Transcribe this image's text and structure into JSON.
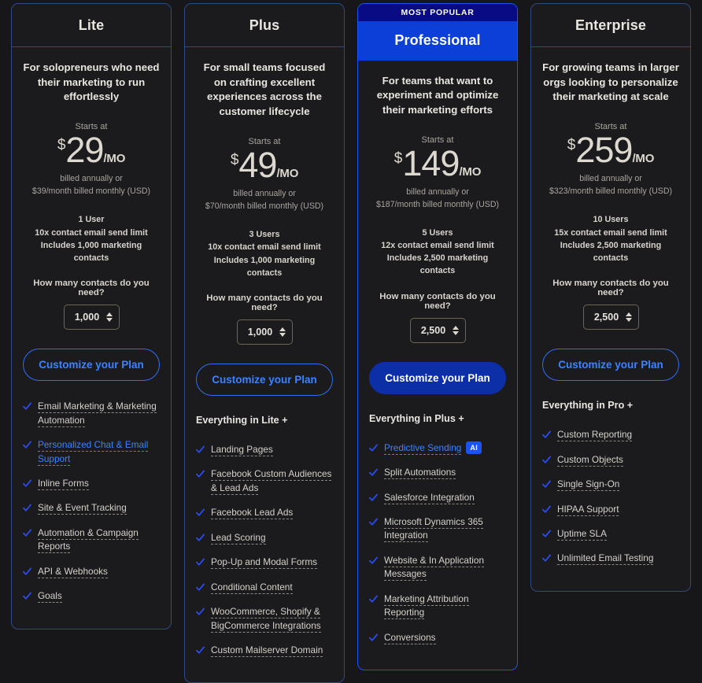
{
  "common": {
    "starts_at_label": "Starts at",
    "currency_symbol": "$",
    "period_label": "/MO",
    "contacts_question": "How many contacts do you need?",
    "cta_label": "Customize your Plan",
    "most_popular_label": "MOST POPULAR",
    "ai_badge_label": "AI",
    "check_icon": "check-icon",
    "stepper_up_icon": "arrow-up-icon",
    "stepper_down_icon": "arrow-down-icon"
  },
  "colors": {
    "page_background": "#17171a",
    "card_background": "#1b1b1e",
    "card_border": "#2c4a86",
    "featured_border": "#1a53f0",
    "featured_header": "#0b3fd8",
    "ribbon": "#080b83",
    "accent_link": "#3d82ff",
    "check_blue": "#2a4df5",
    "stepper_border": "#6e6650",
    "price_text": "#ddd9d0",
    "muted_text": "#a9a59d"
  },
  "plans": [
    {
      "name": "Lite",
      "featured": false,
      "most_popular": false,
      "tagline": "For solopreneurs who need their marketing to run effortlessly",
      "price": "29",
      "billing_note_line1": "billed annually or",
      "billing_note_line2": "$39/month billed monthly (USD)",
      "limits": [
        "1 User",
        "10x contact email send limit",
        "Includes 1,000 marketing contacts"
      ],
      "contacts_value": "1,000",
      "everything_in": "",
      "features": [
        {
          "label": "Email Marketing & Marketing Automation",
          "highlight": false,
          "badge": ""
        },
        {
          "label": "Personalized Chat & Email Support",
          "highlight": true,
          "badge": ""
        },
        {
          "label": "Inline Forms",
          "highlight": false,
          "badge": ""
        },
        {
          "label": "Site & Event Tracking",
          "highlight": false,
          "badge": ""
        },
        {
          "label": "Automation & Campaign Reports",
          "highlight": false,
          "badge": ""
        },
        {
          "label": "API & Webhooks",
          "highlight": false,
          "badge": ""
        },
        {
          "label": "Goals",
          "highlight": false,
          "badge": ""
        }
      ]
    },
    {
      "name": "Plus",
      "featured": false,
      "most_popular": false,
      "tagline": "For small teams focused on crafting excellent experiences across the customer lifecycle",
      "price": "49",
      "billing_note_line1": "billed annually or",
      "billing_note_line2": "$70/month billed monthly (USD)",
      "limits": [
        "3 Users",
        "10x contact email send limit",
        "Includes 1,000 marketing contacts"
      ],
      "contacts_value": "1,000",
      "everything_in": "Everything in Lite +",
      "features": [
        {
          "label": "Landing Pages",
          "highlight": false,
          "badge": ""
        },
        {
          "label": "Facebook Custom Audiences & Lead Ads",
          "highlight": false,
          "badge": ""
        },
        {
          "label": "Facebook Lead Ads",
          "highlight": false,
          "badge": ""
        },
        {
          "label": "Lead Scoring",
          "highlight": false,
          "badge": ""
        },
        {
          "label": "Pop-Up and Modal Forms",
          "highlight": false,
          "badge": ""
        },
        {
          "label": "Conditional Content",
          "highlight": false,
          "badge": ""
        },
        {
          "label": "WooCommerce, Shopify & BigCommerce Integrations",
          "highlight": false,
          "badge": ""
        },
        {
          "label": "Custom Mailserver Domain",
          "highlight": false,
          "badge": ""
        }
      ]
    },
    {
      "name": "Professional",
      "featured": true,
      "most_popular": true,
      "tagline": "For teams that want to experiment and optimize their marketing efforts",
      "price": "149",
      "billing_note_line1": "billed annually or",
      "billing_note_line2": "$187/month billed monthly (USD)",
      "limits": [
        "5 Users",
        "12x contact email send limit",
        "Includes 2,500 marketing contacts"
      ],
      "contacts_value": "2,500",
      "everything_in": "Everything in Plus +",
      "features": [
        {
          "label": "Predictive Sending",
          "highlight": true,
          "badge": "AI"
        },
        {
          "label": "Split Automations",
          "highlight": false,
          "badge": ""
        },
        {
          "label": "Salesforce Integration",
          "highlight": false,
          "badge": ""
        },
        {
          "label": "Microsoft Dynamics 365 Integration",
          "highlight": false,
          "badge": ""
        },
        {
          "label": "Website & In Application Messages",
          "highlight": false,
          "badge": ""
        },
        {
          "label": "Marketing Attribution Reporting",
          "highlight": false,
          "badge": ""
        },
        {
          "label": "Conversions",
          "highlight": false,
          "badge": ""
        }
      ]
    },
    {
      "name": "Enterprise",
      "featured": false,
      "most_popular": false,
      "tagline": "For growing teams in larger orgs looking to personalize their marketing at scale",
      "price": "259",
      "billing_note_line1": "billed annually or",
      "billing_note_line2": "$323/month billed monthly (USD)",
      "limits": [
        "10 Users",
        "15x contact email send limit",
        "Includes 2,500 marketing contacts"
      ],
      "contacts_value": "2,500",
      "everything_in": "Everything in Pro +",
      "features": [
        {
          "label": "Custom Reporting",
          "highlight": false,
          "badge": ""
        },
        {
          "label": "Custom Objects",
          "highlight": false,
          "badge": ""
        },
        {
          "label": "Single Sign-On",
          "highlight": false,
          "badge": ""
        },
        {
          "label": "HIPAA Support",
          "highlight": false,
          "badge": ""
        },
        {
          "label": "Uptime SLA",
          "highlight": false,
          "badge": ""
        },
        {
          "label": "Unlimited Email Testing",
          "highlight": false,
          "badge": ""
        }
      ]
    }
  ]
}
